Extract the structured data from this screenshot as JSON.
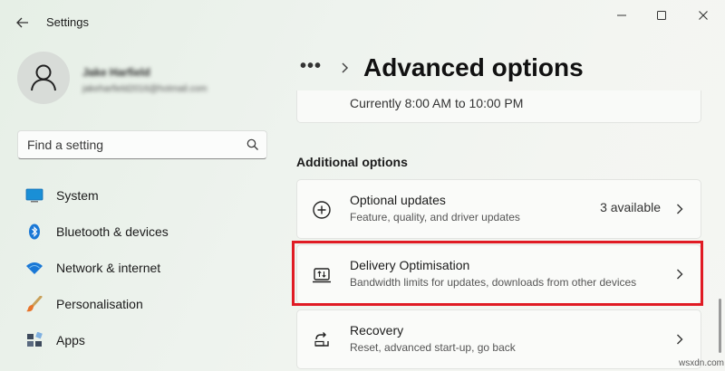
{
  "app": {
    "title": "Settings"
  },
  "profile": {
    "name": "Jake Harfield",
    "email": "jakeharfield2016@hotmail.com"
  },
  "search": {
    "placeholder": "Find a setting"
  },
  "nav": {
    "items": [
      {
        "label": "System",
        "icon": "system-icon"
      },
      {
        "label": "Bluetooth & devices",
        "icon": "bluetooth-icon"
      },
      {
        "label": "Network & internet",
        "icon": "wifi-icon"
      },
      {
        "label": "Personalisation",
        "icon": "brush-icon"
      },
      {
        "label": "Apps",
        "icon": "apps-icon"
      }
    ]
  },
  "main": {
    "breadcrumb_more": "•••",
    "title": "Advanced options",
    "active_hours_text": "Currently 8:00 AM to 10:00 PM",
    "section_heading": "Additional options",
    "cards": [
      {
        "title": "Optional updates",
        "subtitle": "Feature, quality, and driver updates",
        "status": "3 available",
        "icon": "plus-circle-icon"
      },
      {
        "title": "Delivery Optimisation",
        "subtitle": "Bandwidth limits for updates, downloads from other devices",
        "status": "",
        "icon": "delivery-icon"
      },
      {
        "title": "Recovery",
        "subtitle": "Reset, advanced start-up, go back",
        "status": "",
        "icon": "recovery-icon"
      }
    ]
  },
  "watermark": "wsxdn.com",
  "colors": {
    "highlight": "#e01b24",
    "accent": "#0067c0"
  }
}
